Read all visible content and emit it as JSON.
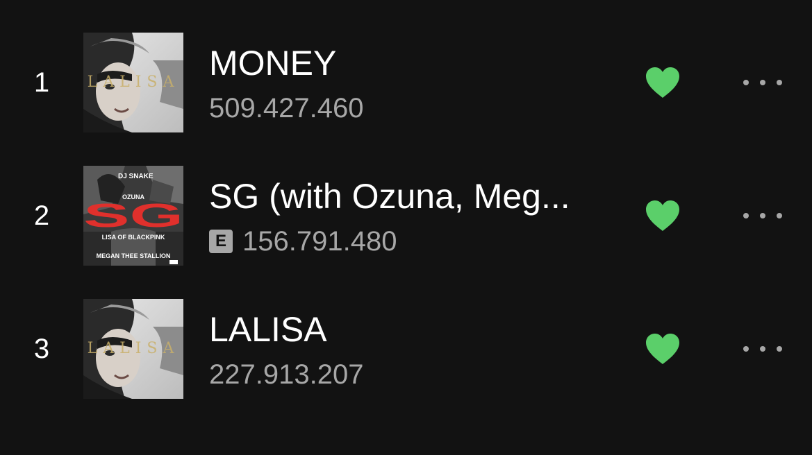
{
  "colors": {
    "background": "#121212",
    "title": "#ffffff",
    "subtext": "#a7a7a7",
    "liked": "#5bcf6a",
    "sg_red": "#e0302c"
  },
  "tracks": [
    {
      "rank": "1",
      "title": "MONEY",
      "plays": "509.427.460",
      "explicit": false,
      "liked": true,
      "cover_text": "LALISA",
      "cover_icon": "lalisa-cover-icon"
    },
    {
      "rank": "2",
      "title": "SG (with Ozuna, Meg...",
      "plays": "156.791.480",
      "explicit": true,
      "explicit_label": "E",
      "liked": true,
      "cover_icon": "sg-cover-icon",
      "cover_lines": {
        "artist1": "DJ SNAKE",
        "artist2": "OZUNA",
        "logo": "SG",
        "artist3": "LISA OF BLACKPINK",
        "artist4": "MEGAN THEE STALLION"
      }
    },
    {
      "rank": "3",
      "title": "LALISA",
      "plays": "227.913.207",
      "explicit": false,
      "liked": true,
      "cover_text": "LALISA",
      "cover_icon": "lalisa-cover-icon"
    }
  ]
}
